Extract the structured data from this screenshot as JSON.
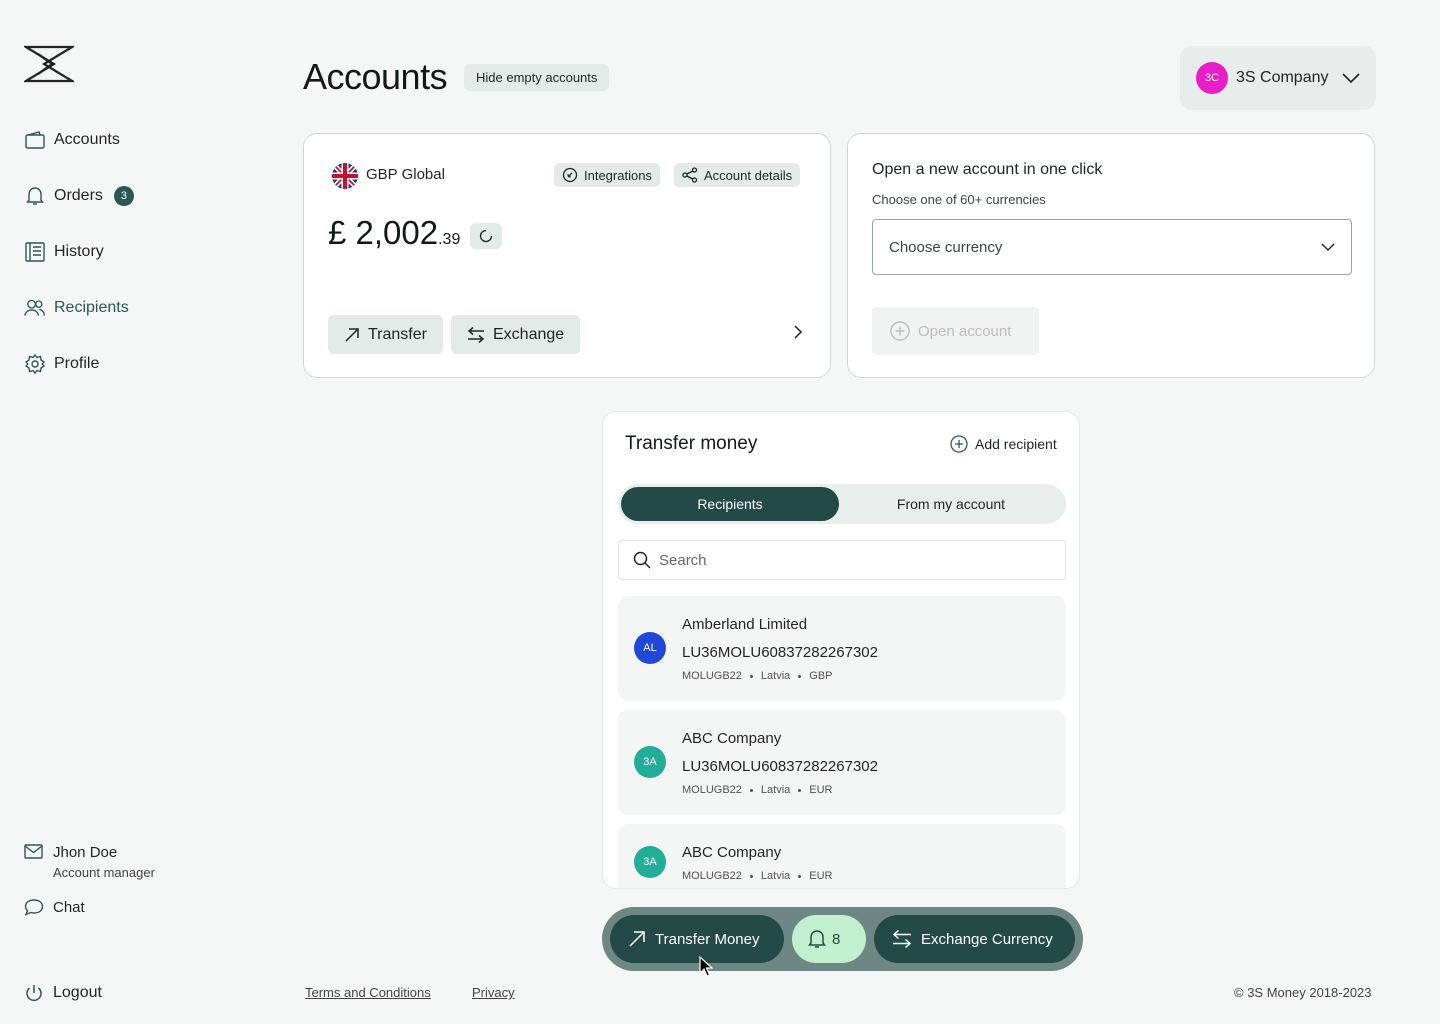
{
  "sidebar": {
    "nav": [
      {
        "label": "Accounts",
        "icon": "wallet-icon"
      },
      {
        "label": "Orders",
        "icon": "bell-icon",
        "badge": "3"
      },
      {
        "label": "History",
        "icon": "document-icon"
      },
      {
        "label": "Recipients",
        "icon": "users-icon",
        "active": true
      },
      {
        "label": "Profile",
        "icon": "gear-icon"
      }
    ],
    "manager": {
      "name": "Jhon Doe",
      "role": "Account manager"
    },
    "chat_label": "Chat",
    "logout_label": "Logout"
  },
  "header": {
    "title": "Accounts",
    "hide_empty_label": "Hide empty accounts",
    "company": {
      "initials": "3C",
      "name": "3S Company",
      "avatar_color": "#e91ec9"
    }
  },
  "account_card": {
    "name": "GBP Global",
    "integrations_label": "Integrations",
    "details_label": "Account details",
    "balance_main": "£ 2,002",
    "balance_cents": ".39",
    "transfer_label": "Transfer",
    "exchange_label": "Exchange"
  },
  "open_account": {
    "title": "Open a new account in one click",
    "subtitle": "Choose one of 60+ currencies",
    "currency_placeholder": "Choose currency",
    "button_label": "Open account"
  },
  "transfer_panel": {
    "title": "Transfer money",
    "add_recipient_label": "Add recipient",
    "tabs": [
      {
        "label": "Recipients",
        "active": true
      },
      {
        "label": "From my account",
        "active": false
      }
    ],
    "search_placeholder": "Search",
    "recipients": [
      {
        "initials": "AL",
        "color": "#1f48d6",
        "name": "Amberland Limited",
        "iban": "LU36MOLU60837282267302",
        "bic": "MOLUGB22",
        "country": "Latvia",
        "currency": "GBP"
      },
      {
        "initials": "3A",
        "color": "#21ad98",
        "name": "ABC Company",
        "iban": "LU36MOLU60837282267302",
        "bic": "MOLUGB22",
        "country": "Latvia",
        "currency": "EUR"
      },
      {
        "initials": "3A",
        "color": "#21ad98",
        "name": "ABC Company",
        "iban": "",
        "bic": "MOLUGB22",
        "country": "Latvia",
        "currency": "EUR"
      }
    ]
  },
  "action_bar": {
    "transfer_label": "Transfer Money",
    "notification_count": "8",
    "exchange_label": "Exchange Currency"
  },
  "footer": {
    "terms_label": "Terms and Conditions",
    "privacy_label": "Privacy",
    "copyright": "© 3S Money 2018-2023"
  },
  "colors": {
    "accent": "#234a46",
    "background": "#f5f7f6",
    "notification_bg": "#c2f0cf"
  }
}
